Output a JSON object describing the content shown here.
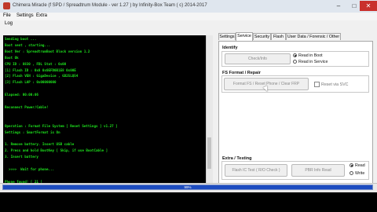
{
  "window": {
    "title": "Chimera Miracle (f SPD / Spreadtrum Module - ver 1.27 ) by Infinity-Box Team ( c) 2014-2017"
  },
  "menu": [
    "File",
    "Settings",
    "Extra"
  ],
  "log_label": "Log",
  "log_lines": [
    "Sending boot ...",
    "Boot sent , starting...",
    "Boot Ver : SpreadtrumBoot Block version 1.2",
    "Boot Ok",
    "CPU ID : 8830 , FDL Stat : 0x00",
    "[1] Flash ID : 0x8 0x0EFD0B1E8 0x00E",
    "[2] Flash VEN : GigaDevice , GD25LQ54",
    "[3] Flash LAP : 0x00000000",
    "",
    "Elapsed: 00:00:06",
    "",
    "Reconnect Power/Cable!",
    "",
    "",
    "Operation : Format File System [ Reset Settings ] v1.27 ]",
    "Settings : SmartFormat is On",
    "",
    "1. Remove battery. Insert USB cable",
    "2. Press and hold BootKey [ Skip, if use BootCable ]",
    "3. Insert battery",
    "",
    "  >>>>  Wait for phone...",
    "",
    "Phone found! [ 21 ]",
    "Port Opened",
    "Sync...",
    "SetBaud Done [ 8e01 ], Ver : SPRD3",
    "Sync...",
    "Sending boot ..."
  ],
  "tabs": [
    "Settings",
    "Service",
    "Security",
    "Flash",
    "User Data / Forensic / Other"
  ],
  "active_tab": "Service",
  "identify": {
    "label": "Identify",
    "check_button": "Check/Info",
    "radio_read_in_boot": "Read in Boot",
    "radio_read_in_service": "Read in Service"
  },
  "fs_format": {
    "label": "FS Format / Repair",
    "format_button": "Format FS / Reset Phone / Clear FRP",
    "reset_via_svc": "Reset via SVC"
  },
  "extra": {
    "label": "Extra / Testing",
    "flash_button": "Flash IC Test ( R/O Check )",
    "pbr_button": "PBR Info Read",
    "radio_read": "Read",
    "radio_write": "Write"
  },
  "progress": {
    "value": 0.99,
    "label": "99%"
  }
}
